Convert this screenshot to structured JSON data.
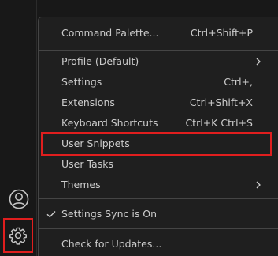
{
  "activity_bar": {
    "account_icon": "account-icon",
    "manage_icon": "gear-icon"
  },
  "menu": {
    "items": [
      {
        "label": "Command Palette...",
        "keybinding": "Ctrl+Shift+P"
      },
      {
        "label": "Profile (Default)",
        "keybinding": "",
        "submenu": true
      },
      {
        "label": "Settings",
        "keybinding": "Ctrl+,"
      },
      {
        "label": "Extensions",
        "keybinding": "Ctrl+Shift+X"
      },
      {
        "label": "Keyboard Shortcuts",
        "keybinding": "Ctrl+K Ctrl+S"
      },
      {
        "label": "User Snippets",
        "keybinding": "",
        "highlighted": true
      },
      {
        "label": "User Tasks",
        "keybinding": ""
      },
      {
        "label": "Themes",
        "keybinding": "",
        "submenu": true
      },
      {
        "label": "Settings Sync is On",
        "keybinding": "",
        "checked": true
      },
      {
        "label": "Check for Updates...",
        "keybinding": ""
      }
    ]
  },
  "colors": {
    "background": "#181818",
    "menu_background": "#1f1f1f",
    "menu_text": "#cccccc",
    "separator": "#454545",
    "highlight_border": "#e01e1e"
  }
}
